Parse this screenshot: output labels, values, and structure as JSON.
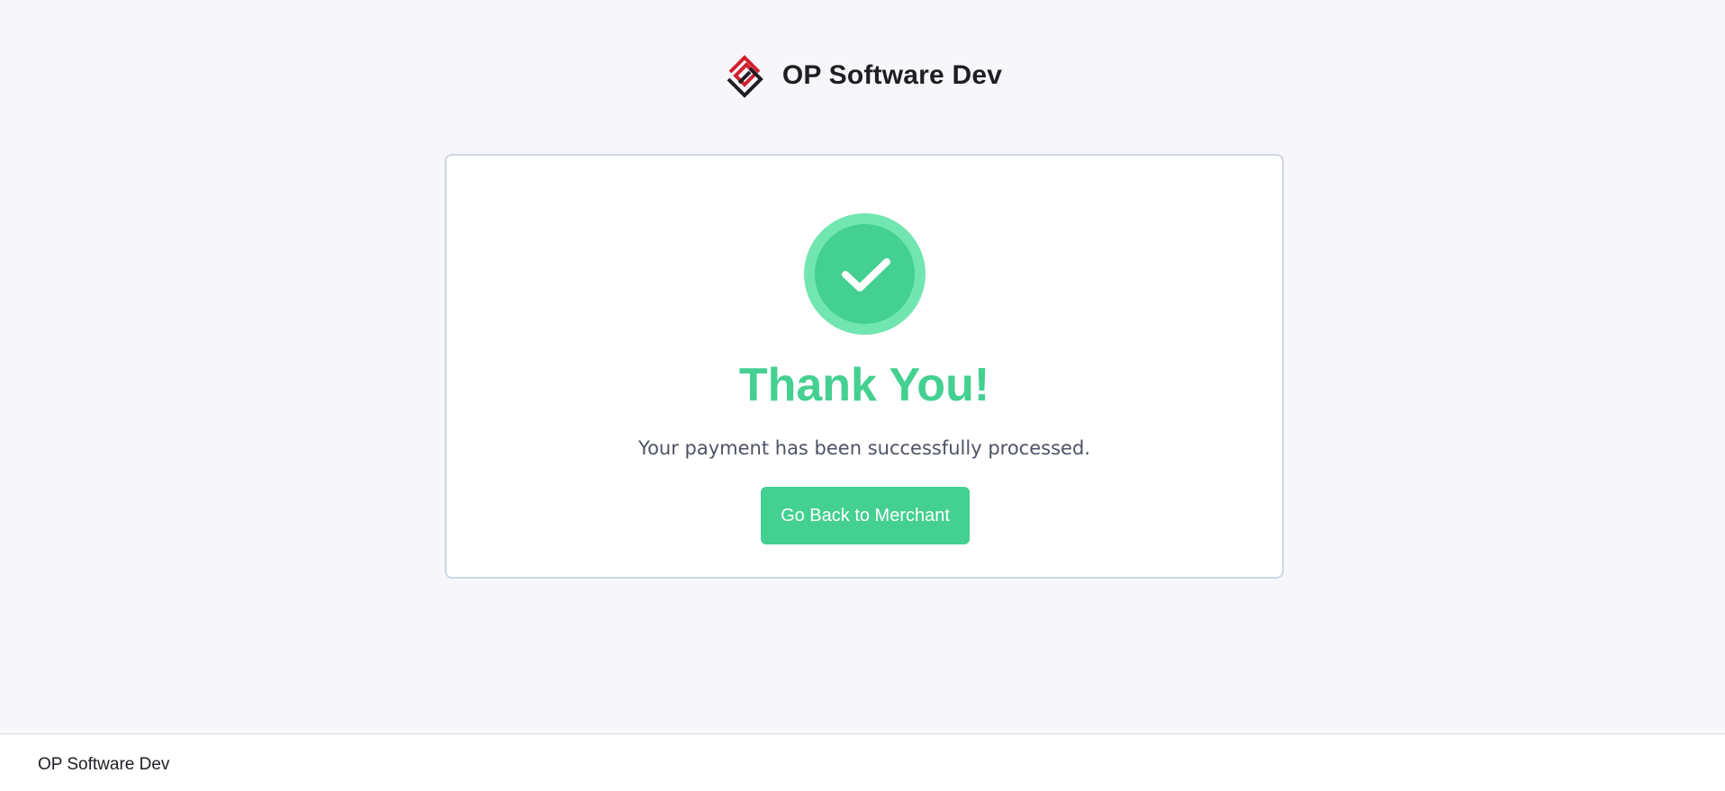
{
  "header": {
    "brand_name": "OP Software Dev",
    "logo_icon": "op-software-logo-icon"
  },
  "card": {
    "status_icon": "checkmark-circle-icon",
    "title": "Thank You!",
    "message": "Your payment has been successfully processed.",
    "button_label": "Go Back to Merchant"
  },
  "footer": {
    "text": "OP Software Dev"
  },
  "colors": {
    "background": "#f7f7fb",
    "success_green": "#43d090",
    "success_green_light": "#72e6b0",
    "logo_red": "#d1202f",
    "logo_dark": "#1e1e24",
    "message_text": "#4e5266",
    "card_border": "#cfd6e3"
  }
}
